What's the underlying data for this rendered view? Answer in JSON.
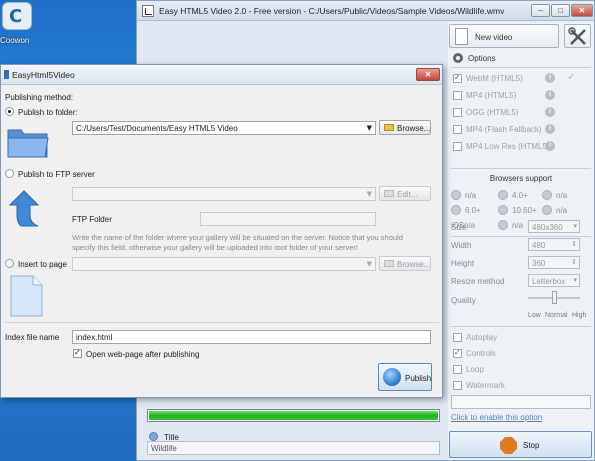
{
  "desktop": {
    "icon_label": "Coowon"
  },
  "main_window": {
    "title": "Easy HTML5 Video 2.0  - Free version - C:/Users/Public/Videos/Sample Videos/Wildlife.wmv",
    "new_video_label": "New video",
    "options_label": "Options",
    "formats": [
      {
        "label": "WebM (HTML5)",
        "checked": true
      },
      {
        "label": "MP4 (HTML5)",
        "checked": false
      },
      {
        "label": "OGG (HTML5)",
        "checked": false
      },
      {
        "label": "MP4 (Flash Fallback)",
        "checked": false
      },
      {
        "label": "MP4 Low Res (HTML5)",
        "checked": false
      }
    ],
    "browsers_support_label": "Browsers support",
    "browsers": [
      {
        "version": "n/a"
      },
      {
        "version": "4.0+"
      },
      {
        "version": "n/a"
      },
      {
        "version": "6.0+"
      },
      {
        "version": "10.60+"
      },
      {
        "version": "n/a"
      },
      {
        "version": "n/a"
      },
      {
        "version": "n/a"
      }
    ],
    "ios_label": "iOS",
    "size": {
      "label": "Size",
      "value": "480x360"
    },
    "width": {
      "label": "Width",
      "value": "480"
    },
    "height": {
      "label": "Height",
      "value": "360"
    },
    "resize_method": {
      "label": "Resize method",
      "value": "Letterbox"
    },
    "quality": {
      "label": "Quality",
      "low": "Low",
      "normal": "Normal",
      "high": "High",
      "level": 0.5
    },
    "playback": [
      {
        "label": "Autoplay",
        "checked": false
      },
      {
        "label": "Controls",
        "checked": true
      },
      {
        "label": "Loop",
        "checked": false
      },
      {
        "label": "Watermark",
        "checked": false
      }
    ],
    "enable_link": "Click to enable this option",
    "stop_label": "Stop",
    "progress": 1.0,
    "title_label": "Title",
    "title_value": "Wildlife",
    "colors": {
      "progress": "#1db01d",
      "stop_icon": "#e07a1c"
    }
  },
  "dialog": {
    "title": "EasyHtml5Video",
    "publishing_method_label": "Publishing method:",
    "publish_to_folder_label": "Publish to folder:",
    "folder_path": "C:/Users/Test/Documents/Easy HTML5 Video",
    "browse_label": "Browse...",
    "publish_to_ftp_label": "Publish to FTP server",
    "edit_label": "Edit...",
    "ftp_folder_label": "FTP Folder",
    "ftp_note": "Write the name of the folder where your gallery will be situated on the server. Notice that you should specify this field, otherwise your gallery will be uploaded into root folder of your server!",
    "insert_to_page_label": "Insert to page",
    "browse2_label": "Browse...",
    "index_file_label": "Index file name",
    "index_file_value": "index.html",
    "open_webpage_label": "Open web-page after publishing",
    "publish_label": "Publish"
  }
}
